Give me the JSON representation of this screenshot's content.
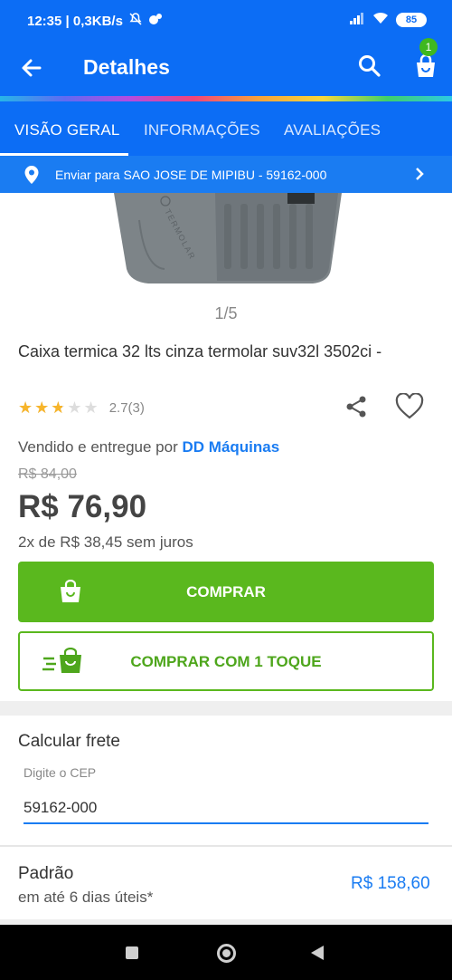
{
  "status_bar": {
    "time_speed": "12:35 | 0,3KB/s",
    "battery": "85",
    "icons": [
      "mute-icon",
      "app-icon",
      "signal-icon",
      "wifi-icon",
      "battery-icon"
    ]
  },
  "app_bar": {
    "title": "Detalhes",
    "cart_count": "1",
    "icons": [
      "back-arrow-icon",
      "search-icon",
      "shopping-bag-icon"
    ]
  },
  "tabs": [
    {
      "label": "VISÃO GERAL",
      "active": true
    },
    {
      "label": "INFORMAÇÕES",
      "active": false
    },
    {
      "label": "AVALIAÇÕES",
      "active": false
    }
  ],
  "shipping_bar": {
    "text": "Enviar para SAO JOSE DE MIPIBU - 59162-000"
  },
  "gallery": {
    "counter": "1/5",
    "brand_text": "TERMOLAR"
  },
  "product": {
    "title": "Caixa termica  32 lts cinza termolar suv32l 3502ci -",
    "rating_text": "2.7(3)",
    "rating_value": 2.7,
    "rating_max": 5,
    "seller_prefix": "Vendido e entregue por",
    "seller_name": "DD Máquinas",
    "old_price": "R$ 84,00",
    "price": "R$ 76,90",
    "installments": "2x de R$ 38,45 sem juros"
  },
  "actions": {
    "buy_label": "COMPRAR",
    "one_touch_label": "COMPRAR COM 1 TOQUE"
  },
  "freight": {
    "title": "Calcular frete",
    "cep_label": "Digite o CEP",
    "cep_value": "59162-000"
  },
  "shipping_option": {
    "name": "Padrão",
    "time": "em até 6 dias úteis*",
    "price": "R$ 158,60"
  },
  "colors": {
    "brand_blue": "#0c6df5",
    "buy_green": "#5ab81e",
    "link_blue": "#1a7cf2",
    "star_gold": "#f7b52b"
  }
}
